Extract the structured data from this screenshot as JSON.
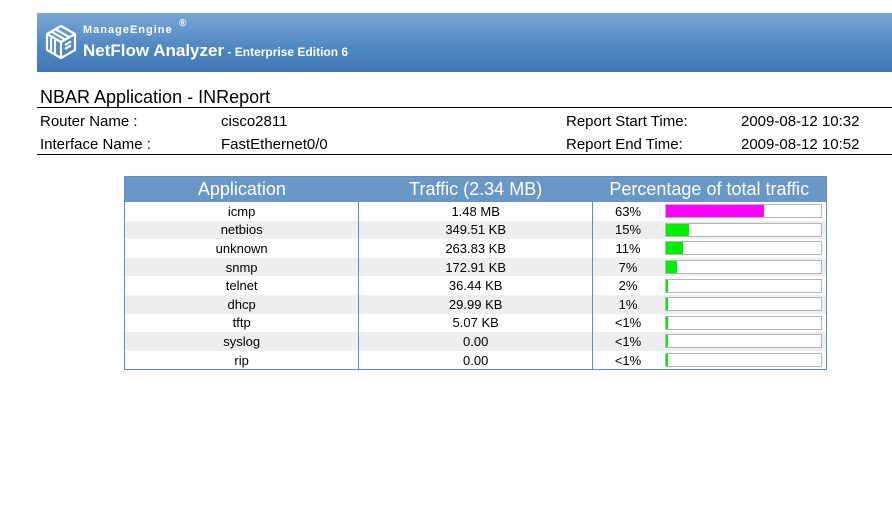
{
  "header": {
    "brand_small": "ManageEngine",
    "registered": "®",
    "product": "NetFlow Analyzer",
    "edition": " - Enterprise Edition 6",
    "logo_icon": "manageengine-cube-icon"
  },
  "report": {
    "title": "NBAR Application - INReport",
    "router_label": "Router Name :",
    "router_value": "cisco2811",
    "interface_label": "Interface Name :",
    "interface_value": "FastEthernet0/0",
    "start_label": "Report Start Time:",
    "start_value": "2009-08-12 10:32",
    "end_label": "Report End Time:",
    "end_value": "2009-08-12 10:52"
  },
  "table": {
    "headers": [
      "Application",
      "Traffic (2.34 MB)",
      "Percentage of total traffic"
    ],
    "rows": [
      {
        "app": "icmp",
        "traffic": "1.48 MB",
        "pct": "63%",
        "fraction": 0.63,
        "color": "#ff00ff"
      },
      {
        "app": "netbios",
        "traffic": "349.51 KB",
        "pct": "15%",
        "fraction": 0.15,
        "color": "#00ee00"
      },
      {
        "app": "unknown",
        "traffic": "263.83 KB",
        "pct": "11%",
        "fraction": 0.11,
        "color": "#00ee00"
      },
      {
        "app": "snmp",
        "traffic": "172.91 KB",
        "pct": "7%",
        "fraction": 0.07,
        "color": "#00ee00"
      },
      {
        "app": "telnet",
        "traffic": "36.44 KB",
        "pct": "2%",
        "fraction": 0.015,
        "color": "#00ee00"
      },
      {
        "app": "dhcp",
        "traffic": "29.99 KB",
        "pct": "1%",
        "fraction": 0.013,
        "color": "#00ee00"
      },
      {
        "app": "tftp",
        "traffic": "5.07 KB",
        "pct": "<1%",
        "fraction": 0.01,
        "color": "#00ee00"
      },
      {
        "app": "syslog",
        "traffic": "0.00",
        "pct": "<1%",
        "fraction": 0.01,
        "color": "#00ee00"
      },
      {
        "app": "rip",
        "traffic": "0.00",
        "pct": "<1%",
        "fraction": 0.01,
        "color": "#00ee00"
      }
    ]
  }
}
